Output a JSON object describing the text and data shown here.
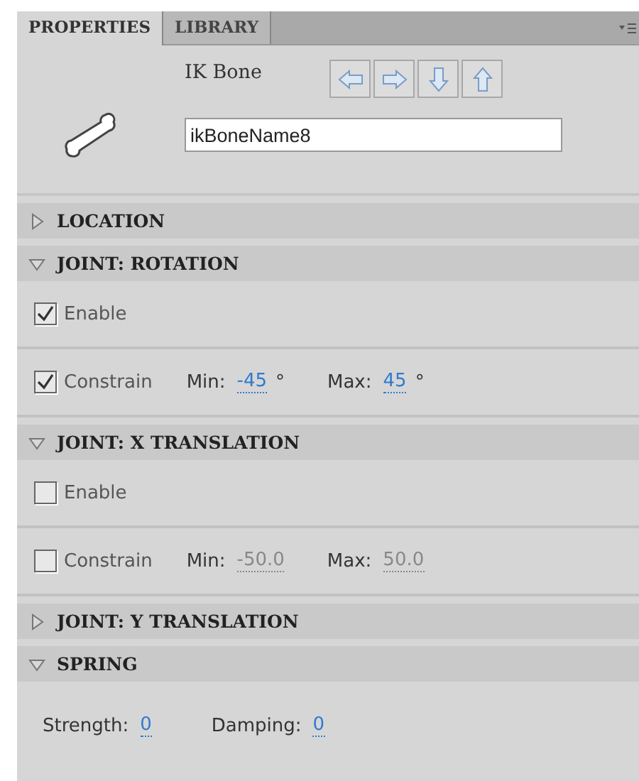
{
  "tabs": [
    {
      "label": "PROPERTIES",
      "selected": true
    },
    {
      "label": "LIBRARY",
      "selected": false
    }
  ],
  "header": {
    "type_label": "IK Bone",
    "name_value": "ikBoneName8"
  },
  "sections": [
    {
      "title": "LOCATION",
      "expanded": false
    },
    {
      "title": "JOINT: ROTATION",
      "expanded": true,
      "rows": [
        {
          "kind": "checkbox",
          "label": "Enable",
          "checked": true
        },
        {
          "kind": "constrain",
          "label": "Constrain",
          "checked": true,
          "disabled": false,
          "min_label": "Min:",
          "min_value": "-45",
          "min_unit": "°",
          "max_label": "Max:",
          "max_value": "45",
          "max_unit": "°"
        }
      ]
    },
    {
      "title": "JOINT: X TRANSLATION",
      "expanded": true,
      "rows": [
        {
          "kind": "checkbox",
          "label": "Enable",
          "checked": false
        },
        {
          "kind": "constrain",
          "label": "Constrain",
          "checked": false,
          "disabled": true,
          "min_label": "Min:",
          "min_value": "-50.0",
          "max_label": "Max:",
          "max_value": "50.0"
        }
      ]
    },
    {
      "title": "JOINT: Y TRANSLATION",
      "expanded": false
    },
    {
      "title": "SPRING",
      "expanded": true,
      "rows": [
        {
          "kind": "spring",
          "strength_label": "Strength:",
          "strength_value": "0",
          "damping_label": "Damping:",
          "damping_value": "0"
        }
      ]
    }
  ]
}
